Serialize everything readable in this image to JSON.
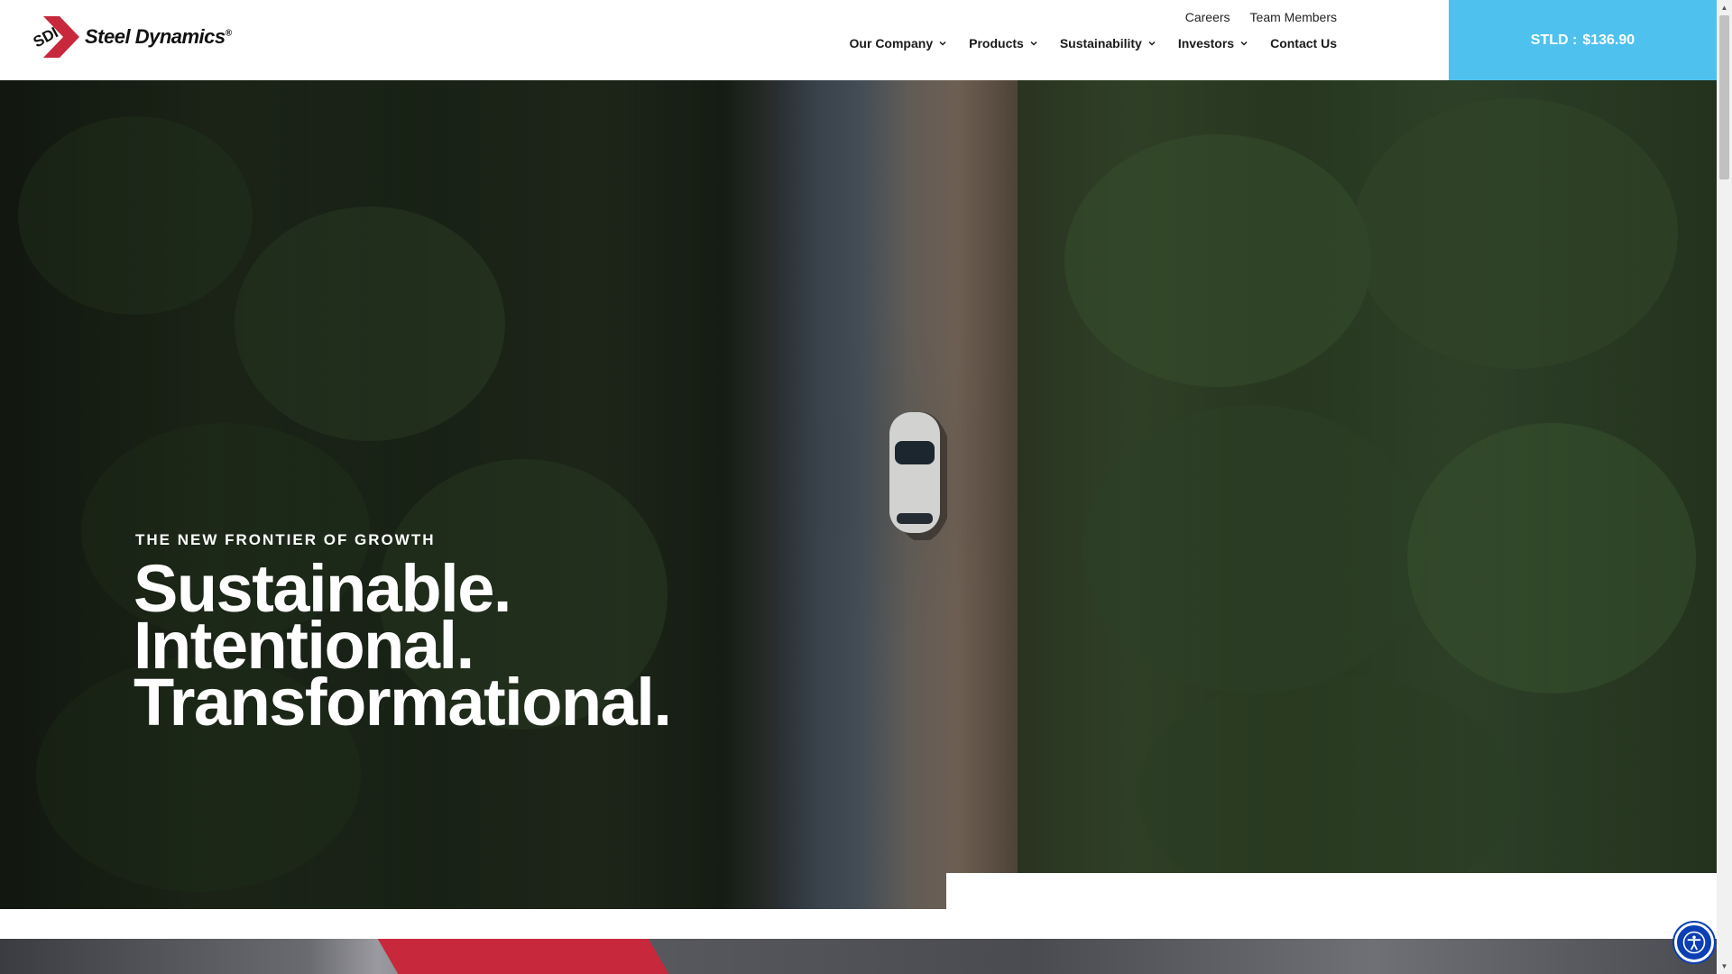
{
  "brand": {
    "mark_text": "SDI",
    "name": "Steel Dynamics",
    "registered": "®",
    "mark_color": "#c8283c"
  },
  "utility_nav": {
    "careers": "Careers",
    "team_members": "Team Members"
  },
  "main_nav": {
    "our_company": "Our Company",
    "products": "Products",
    "sustainability": "Sustainability",
    "investors": "Investors",
    "contact_us": "Contact Us"
  },
  "ticker": {
    "symbol": "STLD :",
    "price": "$136.90",
    "color": "#4fc1ee"
  },
  "hero": {
    "eyebrow": "THE NEW FRONTIER OF GROWTH",
    "line1": "Sustainable.",
    "line2": "Intentional.",
    "line3": "Transformational."
  },
  "icons": {
    "nav_dropdown": "chevron-down-icon",
    "accessibility": "accessibility-icon",
    "scroll_up": "arrow-up-icon",
    "scroll_down": "arrow-down-icon"
  },
  "colors": {
    "accent_red": "#c8283c",
    "accessibility_blue": "#0b3fb3"
  }
}
